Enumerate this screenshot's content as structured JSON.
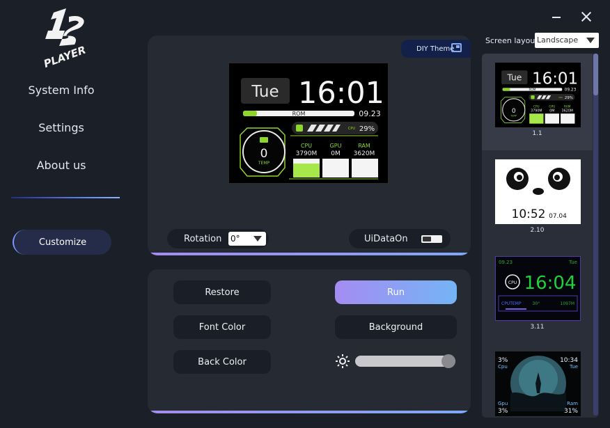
{
  "window": {
    "minimize_label": "minimize",
    "close_label": "close"
  },
  "sidebar": {
    "items": [
      {
        "label": "System Info"
      },
      {
        "label": "Settings"
      },
      {
        "label": "About us"
      }
    ],
    "customize_label": "Customize"
  },
  "preview": {
    "diy_label": "DIY Theme",
    "screen": {
      "day": "Tue",
      "time": "16:01",
      "rom_label": "ROM",
      "date": "09.23",
      "cpu_small": "CPU",
      "cpu_percent": "29%",
      "temp_value": "0",
      "temp_label": "TEMP",
      "stats": [
        {
          "label": "CPU",
          "value": "3790M"
        },
        {
          "label": "GPU",
          "value": "0M"
        },
        {
          "label": "RAM",
          "value": "3620M"
        }
      ]
    },
    "rotation": {
      "label": "Rotation",
      "value": "0°"
    },
    "uidata": {
      "label": "UiDataOn"
    }
  },
  "controls": {
    "restore": "Restore",
    "run": "Run",
    "font_color": "Font Color",
    "background": "Background",
    "back_color": "Back Color",
    "brightness": 0.93
  },
  "layout": {
    "label": "Screen layout",
    "value": "Landscape"
  },
  "themes": [
    {
      "caption": "1.1",
      "day": "Tue",
      "time": "16:01",
      "rom": "ROM",
      "date": "09.23",
      "cpu": "CPU",
      "pct": "29%",
      "temp": "0",
      "temp_label": "TEMP",
      "stats": [
        {
          "label": "CPU",
          "value": "3790M"
        },
        {
          "label": "GPU",
          "value": "0M"
        },
        {
          "label": "RAM",
          "value": "3620M"
        }
      ]
    },
    {
      "caption": "2.10",
      "time": "10:52",
      "date": "07.04"
    },
    {
      "caption": "3.11",
      "date": "09.23",
      "day": "Tue",
      "icon": "CPU",
      "time": "16:04",
      "label": "CPUTEMP",
      "temp": "30°",
      "mem": "1097M"
    },
    {
      "caption": "",
      "tl_value": "3%",
      "tl_label": "Cpu",
      "time": "10:34",
      "day": "Tue",
      "bl_label": "Gpu",
      "bl_value": "3%",
      "br_label": "Ram",
      "br_value": "31%"
    }
  ],
  "colors": {
    "accent_green": "#8fd62a",
    "accent_purple": "#a58cf2",
    "accent_blue": "#74b4f5",
    "panel": "#262a33",
    "background": "#1b1f28"
  }
}
